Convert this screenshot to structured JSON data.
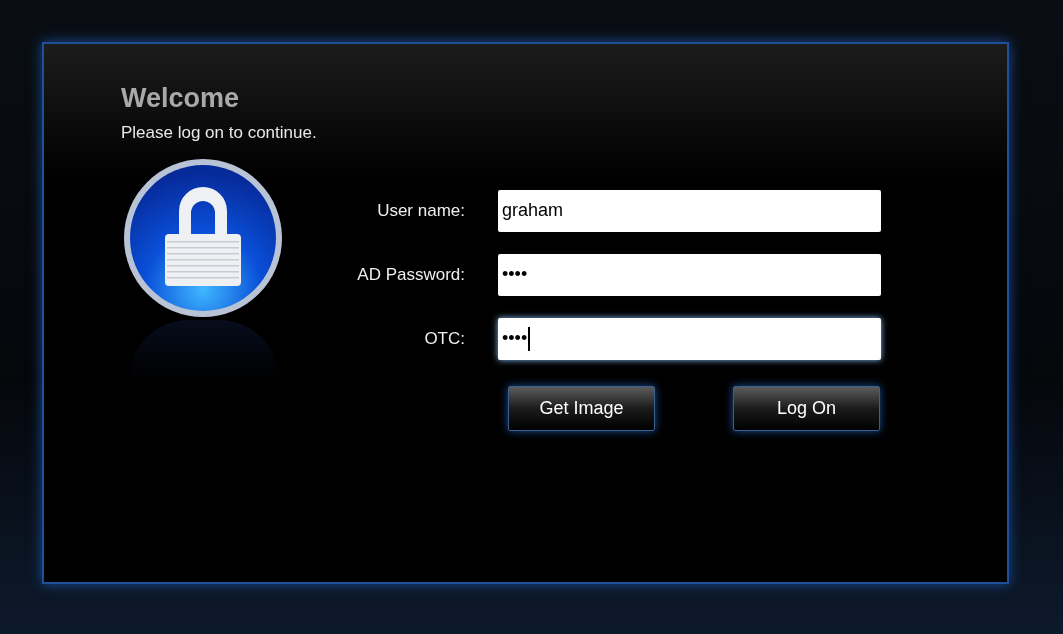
{
  "title": "Welcome",
  "subtitle": "Please log on to continue.",
  "fields": [
    {
      "label": "User name:",
      "value": "graham",
      "focused": false
    },
    {
      "label": "AD Password:",
      "value": "••••",
      "focused": false
    },
    {
      "label": "OTC:",
      "value": "••••",
      "focused": true
    }
  ],
  "buttons": [
    "Get Image",
    "Log On"
  ]
}
